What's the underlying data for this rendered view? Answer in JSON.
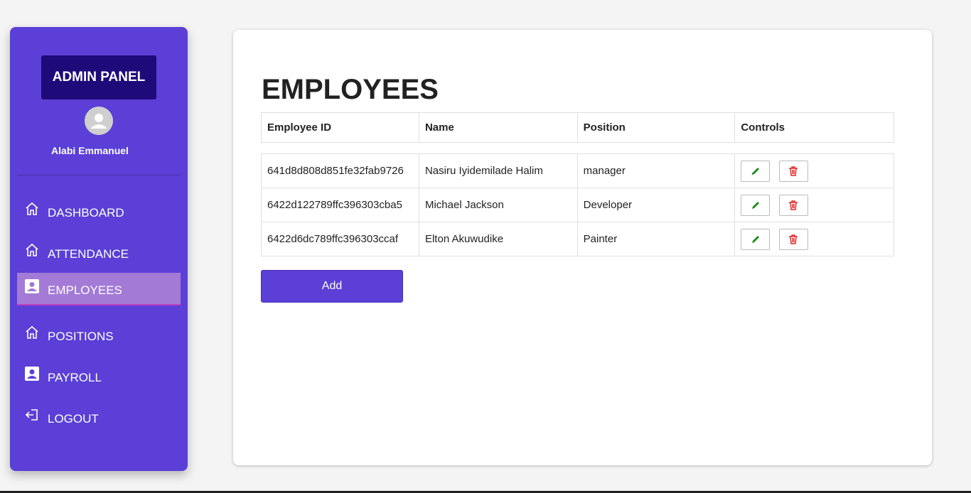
{
  "sidebar": {
    "brand": "ADMIN PANEL",
    "user_name": "Alabi Emmanuel",
    "items": [
      {
        "label": "DASHBOARD",
        "icon": "home-icon"
      },
      {
        "label": "ATTENDANCE",
        "icon": "home-icon"
      },
      {
        "label": "EMPLOYEES",
        "icon": "person-badge-icon",
        "active": true
      },
      {
        "label": "POSITIONS",
        "icon": "home-icon"
      },
      {
        "label": "PAYROLL",
        "icon": "person-badge-icon"
      },
      {
        "label": "LOGOUT",
        "icon": "logout-icon"
      }
    ]
  },
  "main": {
    "title": "EMPLOYEES",
    "table": {
      "headers": [
        "Employee ID",
        "Name",
        "Position",
        "Controls"
      ],
      "rows": [
        {
          "id": "641d8d808d851fe32fab9726",
          "name": "Nasiru Iyidemilade Halim",
          "position": "manager"
        },
        {
          "id": "6422d122789ffc396303cba5",
          "name": "Michael Jackson",
          "position": "Developer"
        },
        {
          "id": "6422d6dc789ffc396303ccaf",
          "name": "Elton Akuwudike",
          "position": "Painter"
        }
      ]
    },
    "add_label": "Add"
  },
  "colors": {
    "sidebar_bg": "#5b3fd6",
    "brand_bg": "#1f0a7a",
    "active_item_bg": "#a37ad6",
    "edit_icon": "#1a8a1a",
    "delete_icon": "#e02020"
  }
}
